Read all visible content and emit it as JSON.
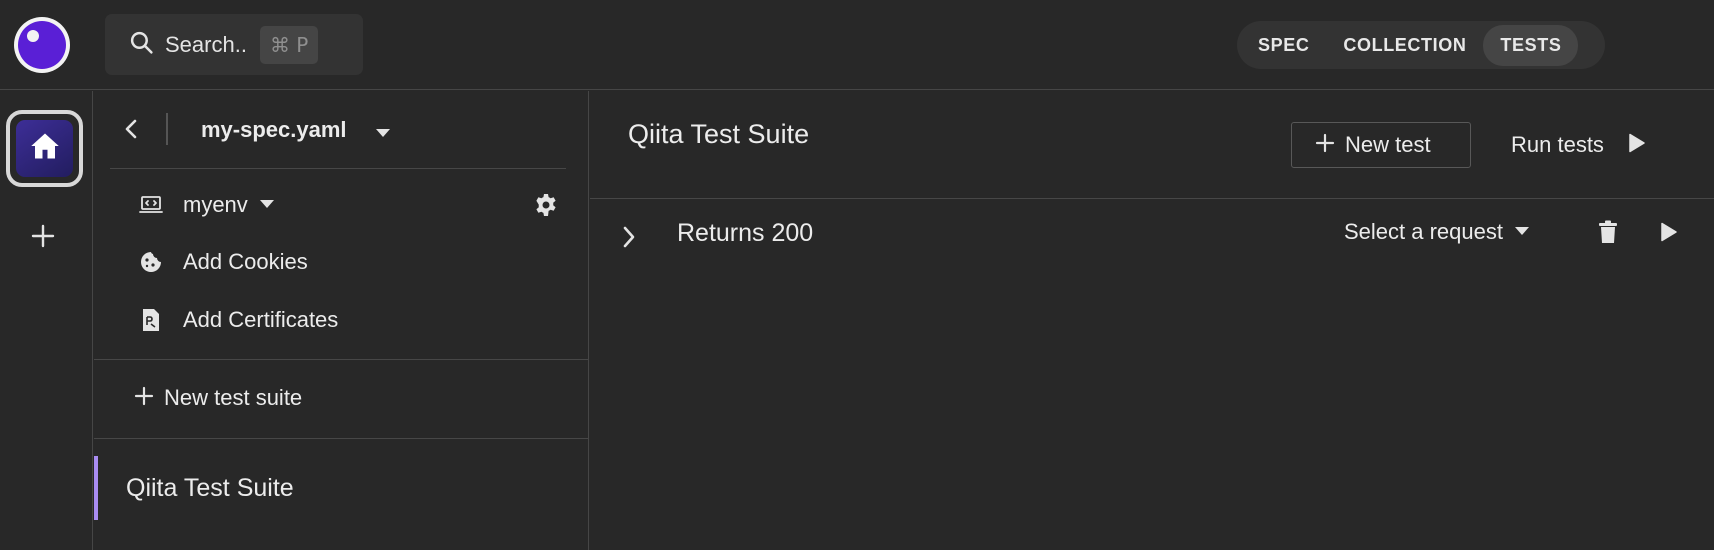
{
  "search": {
    "label": "Search..",
    "shortcut": "⌘ P"
  },
  "mode_tabs": [
    {
      "label": "SPEC",
      "active": false
    },
    {
      "label": "COLLECTION",
      "active": false
    },
    {
      "label": "TESTS",
      "active": true
    }
  ],
  "sidebar": {
    "spec_name": "my-spec.yaml",
    "environment": "myenv",
    "items": [
      {
        "label": "Add Cookies",
        "icon": "cookie-icon"
      },
      {
        "label": "Add Certificates",
        "icon": "certificate-icon"
      }
    ],
    "new_suite_label": "New test suite",
    "suites": [
      {
        "label": "Qiita Test Suite",
        "selected": true
      }
    ]
  },
  "main": {
    "title": "Qiita Test Suite",
    "new_test_label": "New test",
    "run_tests_label": "Run tests",
    "tests": [
      {
        "name": "Returns 200",
        "request_placeholder": "Select a request"
      }
    ]
  },
  "colors": {
    "background": "#282828",
    "accent": "#5a1fd6",
    "selection_bar": "#a98cf2",
    "divider": "#464646"
  }
}
